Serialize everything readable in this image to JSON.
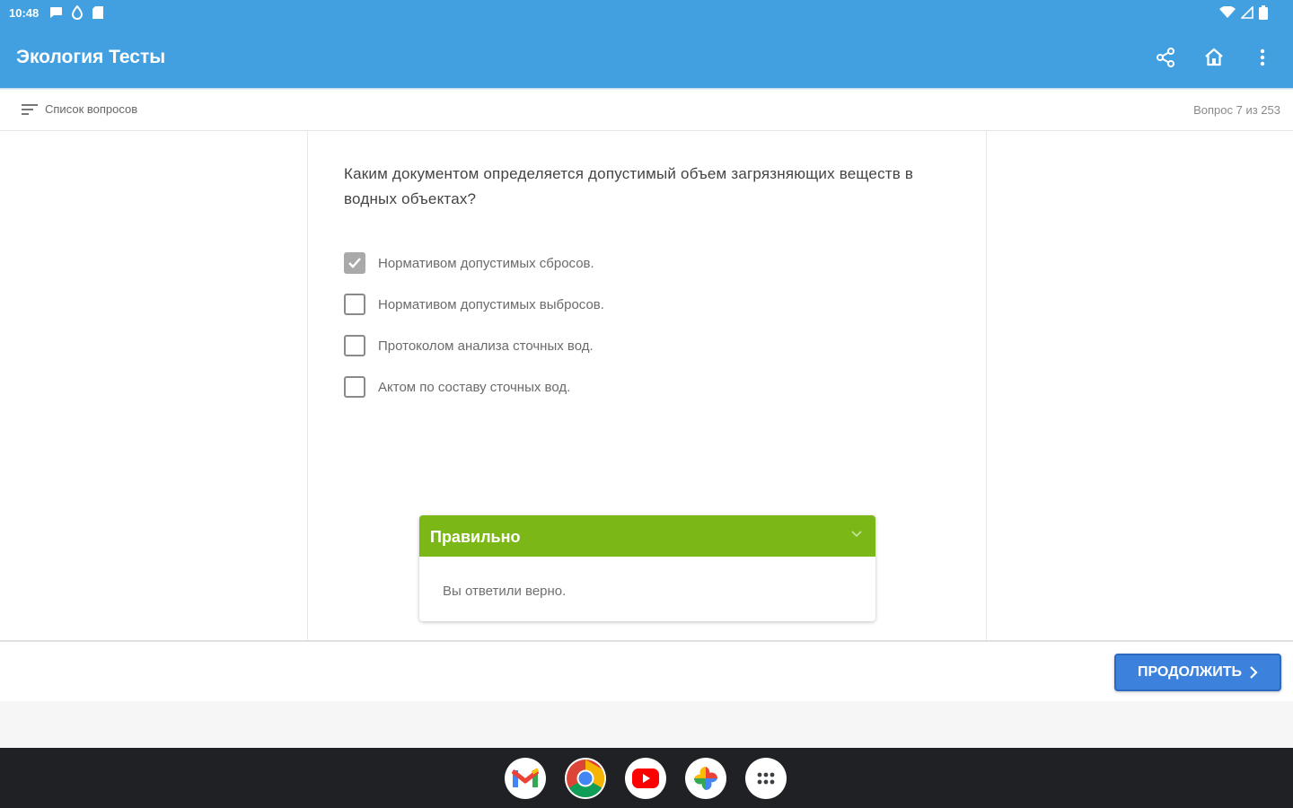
{
  "status_bar": {
    "time": "10:48",
    "left_icons": [
      "chat-bubble-icon",
      "drop-icon",
      "sd-card-icon"
    ],
    "right_icons": [
      "wifi-icon",
      "signal-icon",
      "battery-icon"
    ]
  },
  "app_bar": {
    "title": "Экология Тесты",
    "actions": [
      "share-icon",
      "home-icon",
      "more-vert-icon"
    ]
  },
  "toolbar": {
    "list_label": "Список вопросов",
    "counter": "Вопрос 7 из 253"
  },
  "question": {
    "text": "Каким документом определяется допустимый объем загрязняющих веществ в водных объектах?",
    "answers": [
      {
        "label": "Нормативом допустимых сбросов.",
        "checked": true
      },
      {
        "label": "Нормативом допустимых выбросов.",
        "checked": false
      },
      {
        "label": "Протоколом анализа сточных вод.",
        "checked": false
      },
      {
        "label": "Актом по составу сточных вод.",
        "checked": false
      }
    ]
  },
  "feedback": {
    "title": "Правильно",
    "body": "Вы ответили верно.",
    "color": "#7cb718"
  },
  "bottom": {
    "continue_label": "ПРОДОЛЖИТЬ"
  },
  "dock_apps": [
    "gmail-icon",
    "chrome-icon",
    "youtube-icon",
    "photos-icon",
    "app-launcher-icon"
  ],
  "colors": {
    "app_bar": "#42a0e0",
    "button": "#3c82dc",
    "taskbar": "#202124"
  }
}
